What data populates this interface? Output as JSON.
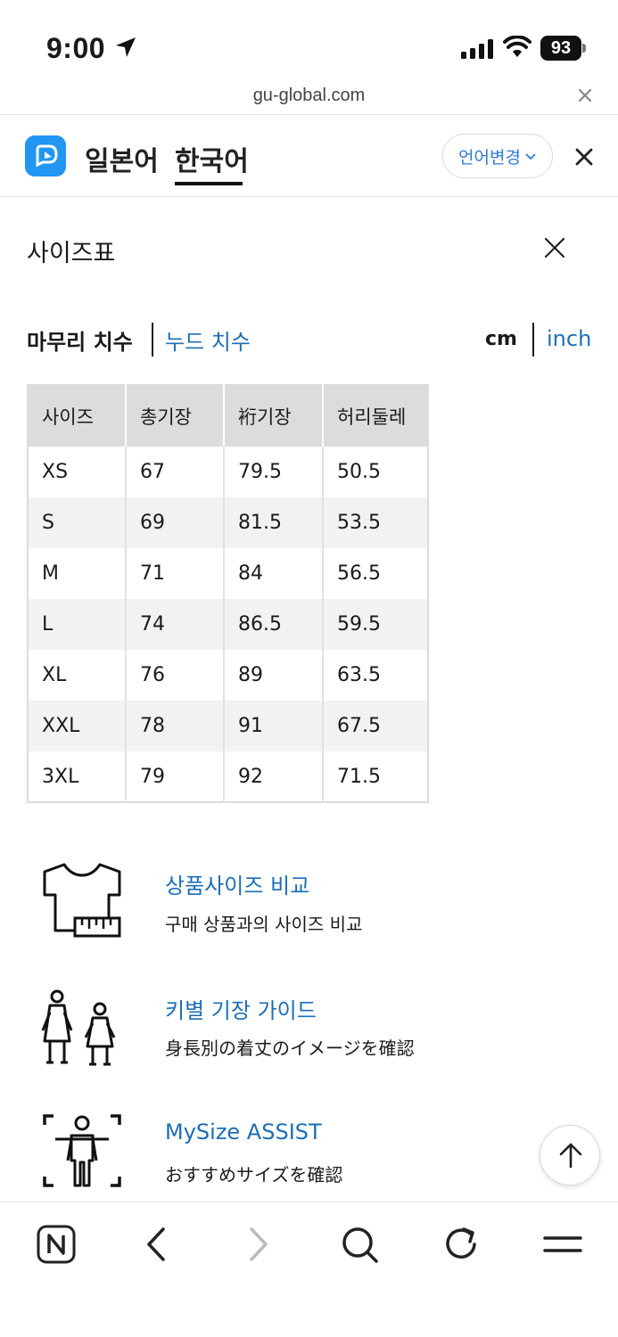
{
  "status_bar": {
    "time": "9:00",
    "battery": "93"
  },
  "browser": {
    "url": "gu-global.com"
  },
  "translator": {
    "lang_tabs": [
      "일본어",
      "한국어"
    ],
    "change_language": "언어변경"
  },
  "size_chart": {
    "title": "사이즈표",
    "tab_finish": "마무리 치수",
    "tab_nude": "누드 치수",
    "unit_cm": "cm",
    "unit_inch": "inch",
    "headers": [
      "사이즈",
      "총기장",
      "裄기장",
      "허리둘레"
    ],
    "rows": [
      [
        "XS",
        "67",
        "79.5",
        "50.5"
      ],
      [
        "S",
        "69",
        "81.5",
        "53.5"
      ],
      [
        "M",
        "71",
        "84",
        "56.5"
      ],
      [
        "L",
        "74",
        "86.5",
        "59.5"
      ],
      [
        "XL",
        "76",
        "89",
        "63.5"
      ],
      [
        "XXL",
        "78",
        "91",
        "67.5"
      ],
      [
        "3XL",
        "79",
        "92",
        "71.5"
      ]
    ]
  },
  "features": [
    {
      "title": "상품사이즈 비교",
      "desc": "구매 상품과의 사이즈 비교",
      "icon": "tshirt-ruler-icon"
    },
    {
      "title": "키별 기장 가이드",
      "desc": "身長別の着丈のイメージを確認",
      "icon": "height-guide-icon"
    },
    {
      "title": "MySize ASSIST",
      "desc": "おすすめサイズを確認",
      "icon": "body-scan-icon"
    }
  ],
  "colors": {
    "link": "#1a6fb8",
    "header_bg": "#dcdcdc",
    "row_alt": "#f2f2f2",
    "app_blue": "#2196f3"
  }
}
